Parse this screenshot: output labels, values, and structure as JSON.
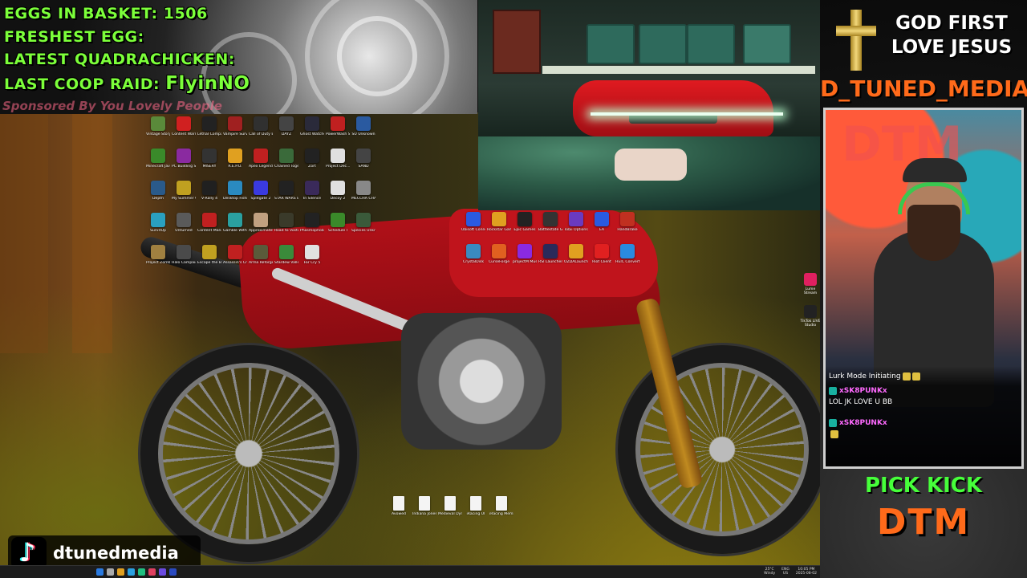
{
  "overlay": {
    "eggs_label": "EGGS IN BASKET:",
    "eggs_value": "1506",
    "freshest_label": "FRESHEST EGG:",
    "quadrachicken_label": "LATEST QUADRACHICKEN:",
    "coop_raid_label": "LAST COOP RAID:",
    "coop_raid_value": "FlyinNO",
    "sponsor": "Sponsored By You Lovely People"
  },
  "right_panel": {
    "line1": "GOD FIRST",
    "line2": "LOVE JESUS",
    "channel": "D_TUNED_MEDIA",
    "pick": "PICK KICK",
    "brand": "DTM"
  },
  "chat": {
    "line1": "Lurk Mode Initiating",
    "user1": "xSK8PUNKx",
    "msg1": "LOL JK LOVE U BB",
    "user2": "xSK8PUNKx"
  },
  "tiktok": {
    "handle": "dtunedmedia"
  },
  "desktop": {
    "grid_a": [
      {
        "label": "Vintage Story",
        "color": "#5a8a3a"
      },
      {
        "label": "Content Warning",
        "color": "#d02020"
      },
      {
        "label": "Lethal Company",
        "color": "#222222"
      },
      {
        "label": "Vampire Survivors",
        "color": "#a02020"
      },
      {
        "label": "Call of Duty Bla...",
        "color": "#303030"
      },
      {
        "label": "DAYZ",
        "color": "#444444"
      },
      {
        "label": "Ghost Watchers",
        "color": "#2a2a3a"
      },
      {
        "label": "PowerWash Sim",
        "color": "#c02020"
      },
      {
        "label": "SU Unknown",
        "color": "#2a5aa0"
      },
      {
        "label": "Minecraft Java Edition",
        "color": "#3a8a2a"
      },
      {
        "label": "PC Building Simulator 2",
        "color": "#8a2aa0"
      },
      {
        "label": "MISERY",
        "color": "#333333"
      },
      {
        "label": "R.E.P.O.",
        "color": "#e0a020"
      },
      {
        "label": "Apex Legends",
        "color": "#c02020"
      },
      {
        "label": "Chained Together",
        "color": "#3a6a3a"
      },
      {
        "label": "Zort",
        "color": "#222222"
      },
      {
        "label": "Project Dec...",
        "color": "#e0e0e0"
      },
      {
        "label": "SAND",
        "color": "#444444"
      },
      {
        "label": "Depth",
        "color": "#2a5a8a"
      },
      {
        "label": "My Summer Car",
        "color": "#c0a020"
      },
      {
        "label": "V-Rally 4",
        "color": "#202020"
      },
      {
        "label": "Desktop Fishing",
        "color": "#2a8ac0"
      },
      {
        "label": "Splitgate 2",
        "color": "#3a3ae0"
      },
      {
        "label": "STAR WARS Battlefront",
        "color": "#222222"
      },
      {
        "label": "In Silence",
        "color": "#3a2a5a"
      },
      {
        "label": "Decoy 2",
        "color": "#e0e0e0"
      },
      {
        "label": "MECCHA CHAMBER",
        "color": "#888888"
      },
      {
        "label": "SurvitUp",
        "color": "#2aa0c0"
      },
      {
        "label": "Unturned",
        "color": "#5a5a5a"
      },
      {
        "label": "Content Manager",
        "color": "#c02020"
      },
      {
        "label": "Gamble With Your Friends",
        "color": "#2aa0a0"
      },
      {
        "label": "Approximately Up Demo",
        "color": "#c0a080"
      },
      {
        "label": "Road to Vostok",
        "color": "#3a3a2a"
      },
      {
        "label": "Phasmophobia",
        "color": "#222222"
      },
      {
        "label": "Schedule I",
        "color": "#3a8a2a"
      },
      {
        "label": "Species Unknown",
        "color": "#3a5a3a"
      },
      {
        "label": "Project Zomboid",
        "color": "#a08040"
      },
      {
        "label": "Halo Campaign",
        "color": "#4a4a4a"
      },
      {
        "label": "Escape the Backrooms",
        "color": "#c0a020"
      },
      {
        "label": "Assassin's Creed",
        "color": "#c02020"
      },
      {
        "label": "Arma Reforger",
        "color": "#5a5a3a"
      },
      {
        "label": "Stardew Valley",
        "color": "#3a8a3a"
      },
      {
        "label": "Far Cry 5",
        "color": "#e0e0e0"
      }
    ],
    "grid_b": [
      {
        "label": "Ubisoft Connect",
        "color": "#2a5ae0"
      },
      {
        "label": "Rockstar Games",
        "color": "#e0a020"
      },
      {
        "label": "Epic Games",
        "color": "#222222"
      },
      {
        "label": "Battlestate Games",
        "color": "#333333"
      },
      {
        "label": "Tobii Options",
        "color": "#6a3ac0"
      },
      {
        "label": "EA",
        "color": "#2a5ae0"
      },
      {
        "label": "HandBrake",
        "color": "#c03020"
      },
      {
        "label": "CrystalDisk",
        "color": "#3a8ac0"
      },
      {
        "label": "CurseForge",
        "color": "#e06020"
      },
      {
        "label": "projectM Music",
        "color": "#8a2ae0"
      },
      {
        "label": "RSI Launcher",
        "color": "#2a2a5a"
      },
      {
        "label": "OZDALauncher",
        "color": "#e0a020"
      },
      {
        "label": "Riot Client",
        "color": "#e02020"
      },
      {
        "label": "HEIC Converter",
        "color": "#2a8ae0"
      }
    ],
    "files": [
      {
        "label": "Avowed"
      },
      {
        "label": "Indiana Jones and the Gre..."
      },
      {
        "label": "Medieval Dynasty"
      },
      {
        "label": "iRacing UI"
      },
      {
        "label": "iRacing Memb..."
      }
    ],
    "side_apps": [
      {
        "label": "Lume Stream",
        "color": "#e02060"
      },
      {
        "label": "TikTok LIVE Studio",
        "color": "#222222"
      }
    ]
  },
  "taskbar": {
    "weather_temp": "25°C",
    "weather_desc": "Windy",
    "lang": "ENG",
    "region": "US",
    "time": "10:05 PM",
    "date": "2025-08-02"
  }
}
